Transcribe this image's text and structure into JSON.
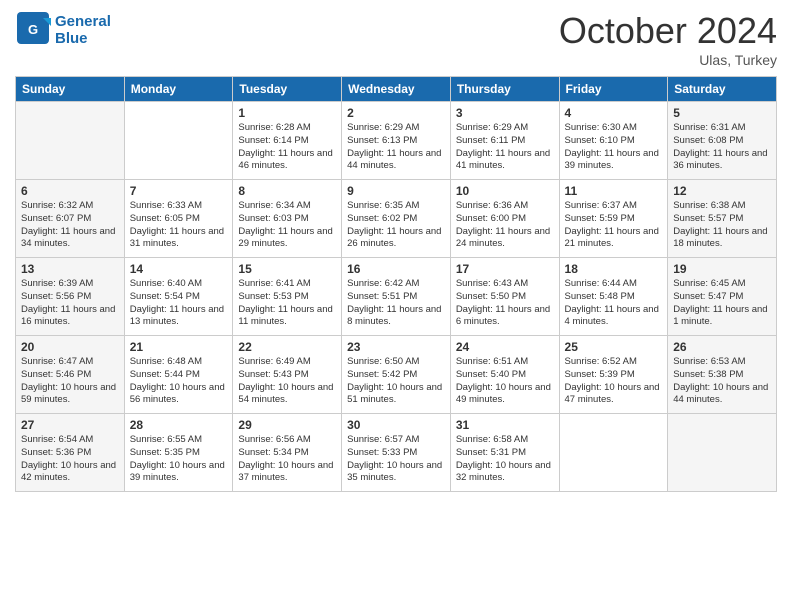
{
  "header": {
    "logo_line1": "General",
    "logo_line2": "Blue",
    "month_title": "October 2024",
    "subtitle": "Ulas, Turkey"
  },
  "weekdays": [
    "Sunday",
    "Monday",
    "Tuesday",
    "Wednesday",
    "Thursday",
    "Friday",
    "Saturday"
  ],
  "weeks": [
    [
      {
        "day": "",
        "sunrise": "",
        "sunset": "",
        "daylight": ""
      },
      {
        "day": "",
        "sunrise": "",
        "sunset": "",
        "daylight": ""
      },
      {
        "day": "1",
        "sunrise": "Sunrise: 6:28 AM",
        "sunset": "Sunset: 6:14 PM",
        "daylight": "Daylight: 11 hours and 46 minutes."
      },
      {
        "day": "2",
        "sunrise": "Sunrise: 6:29 AM",
        "sunset": "Sunset: 6:13 PM",
        "daylight": "Daylight: 11 hours and 44 minutes."
      },
      {
        "day": "3",
        "sunrise": "Sunrise: 6:29 AM",
        "sunset": "Sunset: 6:11 PM",
        "daylight": "Daylight: 11 hours and 41 minutes."
      },
      {
        "day": "4",
        "sunrise": "Sunrise: 6:30 AM",
        "sunset": "Sunset: 6:10 PM",
        "daylight": "Daylight: 11 hours and 39 minutes."
      },
      {
        "day": "5",
        "sunrise": "Sunrise: 6:31 AM",
        "sunset": "Sunset: 6:08 PM",
        "daylight": "Daylight: 11 hours and 36 minutes."
      }
    ],
    [
      {
        "day": "6",
        "sunrise": "Sunrise: 6:32 AM",
        "sunset": "Sunset: 6:07 PM",
        "daylight": "Daylight: 11 hours and 34 minutes."
      },
      {
        "day": "7",
        "sunrise": "Sunrise: 6:33 AM",
        "sunset": "Sunset: 6:05 PM",
        "daylight": "Daylight: 11 hours and 31 minutes."
      },
      {
        "day": "8",
        "sunrise": "Sunrise: 6:34 AM",
        "sunset": "Sunset: 6:03 PM",
        "daylight": "Daylight: 11 hours and 29 minutes."
      },
      {
        "day": "9",
        "sunrise": "Sunrise: 6:35 AM",
        "sunset": "Sunset: 6:02 PM",
        "daylight": "Daylight: 11 hours and 26 minutes."
      },
      {
        "day": "10",
        "sunrise": "Sunrise: 6:36 AM",
        "sunset": "Sunset: 6:00 PM",
        "daylight": "Daylight: 11 hours and 24 minutes."
      },
      {
        "day": "11",
        "sunrise": "Sunrise: 6:37 AM",
        "sunset": "Sunset: 5:59 PM",
        "daylight": "Daylight: 11 hours and 21 minutes."
      },
      {
        "day": "12",
        "sunrise": "Sunrise: 6:38 AM",
        "sunset": "Sunset: 5:57 PM",
        "daylight": "Daylight: 11 hours and 18 minutes."
      }
    ],
    [
      {
        "day": "13",
        "sunrise": "Sunrise: 6:39 AM",
        "sunset": "Sunset: 5:56 PM",
        "daylight": "Daylight: 11 hours and 16 minutes."
      },
      {
        "day": "14",
        "sunrise": "Sunrise: 6:40 AM",
        "sunset": "Sunset: 5:54 PM",
        "daylight": "Daylight: 11 hours and 13 minutes."
      },
      {
        "day": "15",
        "sunrise": "Sunrise: 6:41 AM",
        "sunset": "Sunset: 5:53 PM",
        "daylight": "Daylight: 11 hours and 11 minutes."
      },
      {
        "day": "16",
        "sunrise": "Sunrise: 6:42 AM",
        "sunset": "Sunset: 5:51 PM",
        "daylight": "Daylight: 11 hours and 8 minutes."
      },
      {
        "day": "17",
        "sunrise": "Sunrise: 6:43 AM",
        "sunset": "Sunset: 5:50 PM",
        "daylight": "Daylight: 11 hours and 6 minutes."
      },
      {
        "day": "18",
        "sunrise": "Sunrise: 6:44 AM",
        "sunset": "Sunset: 5:48 PM",
        "daylight": "Daylight: 11 hours and 4 minutes."
      },
      {
        "day": "19",
        "sunrise": "Sunrise: 6:45 AM",
        "sunset": "Sunset: 5:47 PM",
        "daylight": "Daylight: 11 hours and 1 minute."
      }
    ],
    [
      {
        "day": "20",
        "sunrise": "Sunrise: 6:47 AM",
        "sunset": "Sunset: 5:46 PM",
        "daylight": "Daylight: 10 hours and 59 minutes."
      },
      {
        "day": "21",
        "sunrise": "Sunrise: 6:48 AM",
        "sunset": "Sunset: 5:44 PM",
        "daylight": "Daylight: 10 hours and 56 minutes."
      },
      {
        "day": "22",
        "sunrise": "Sunrise: 6:49 AM",
        "sunset": "Sunset: 5:43 PM",
        "daylight": "Daylight: 10 hours and 54 minutes."
      },
      {
        "day": "23",
        "sunrise": "Sunrise: 6:50 AM",
        "sunset": "Sunset: 5:42 PM",
        "daylight": "Daylight: 10 hours and 51 minutes."
      },
      {
        "day": "24",
        "sunrise": "Sunrise: 6:51 AM",
        "sunset": "Sunset: 5:40 PM",
        "daylight": "Daylight: 10 hours and 49 minutes."
      },
      {
        "day": "25",
        "sunrise": "Sunrise: 6:52 AM",
        "sunset": "Sunset: 5:39 PM",
        "daylight": "Daylight: 10 hours and 47 minutes."
      },
      {
        "day": "26",
        "sunrise": "Sunrise: 6:53 AM",
        "sunset": "Sunset: 5:38 PM",
        "daylight": "Daylight: 10 hours and 44 minutes."
      }
    ],
    [
      {
        "day": "27",
        "sunrise": "Sunrise: 6:54 AM",
        "sunset": "Sunset: 5:36 PM",
        "daylight": "Daylight: 10 hours and 42 minutes."
      },
      {
        "day": "28",
        "sunrise": "Sunrise: 6:55 AM",
        "sunset": "Sunset: 5:35 PM",
        "daylight": "Daylight: 10 hours and 39 minutes."
      },
      {
        "day": "29",
        "sunrise": "Sunrise: 6:56 AM",
        "sunset": "Sunset: 5:34 PM",
        "daylight": "Daylight: 10 hours and 37 minutes."
      },
      {
        "day": "30",
        "sunrise": "Sunrise: 6:57 AM",
        "sunset": "Sunset: 5:33 PM",
        "daylight": "Daylight: 10 hours and 35 minutes."
      },
      {
        "day": "31",
        "sunrise": "Sunrise: 6:58 AM",
        "sunset": "Sunset: 5:31 PM",
        "daylight": "Daylight: 10 hours and 32 minutes."
      },
      {
        "day": "",
        "sunrise": "",
        "sunset": "",
        "daylight": ""
      },
      {
        "day": "",
        "sunrise": "",
        "sunset": "",
        "daylight": ""
      }
    ]
  ]
}
